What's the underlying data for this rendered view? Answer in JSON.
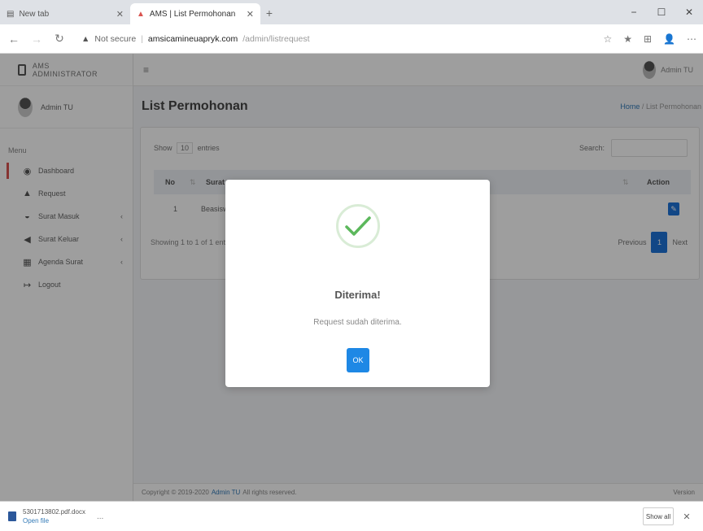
{
  "browser": {
    "tabs": [
      {
        "title": "New tab",
        "active": false
      },
      {
        "title": "AMS | List Permohonan",
        "active": true
      }
    ],
    "new_tab": "+",
    "window": {
      "minimize": "−",
      "maximize": "☐",
      "close": "✕"
    },
    "nav": {
      "back": "←",
      "forward": "→",
      "reload": "↻"
    },
    "address": {
      "security": "Not secure",
      "separator": "|",
      "host": "amsicamineuapryk.com",
      "path": "/admin/listrequest"
    },
    "tools": [
      "☆",
      "★",
      "⊞",
      "👤",
      "⋯"
    ]
  },
  "app": {
    "brand": "AMS ADMINISTRATOR",
    "user_name": "Admin TU",
    "menu_label": "Menu",
    "nav_items": [
      {
        "label": "Dashboard",
        "icon": "dashboard-icon",
        "glyph": "◉",
        "caret": ""
      },
      {
        "label": "Request",
        "icon": "request-icon",
        "glyph": "▲",
        "caret": ""
      },
      {
        "label": "Surat Masuk",
        "icon": "inbox-icon",
        "glyph": "◒",
        "caret": "‹"
      },
      {
        "label": "Surat Keluar",
        "icon": "send-icon",
        "glyph": "◀",
        "caret": "‹"
      },
      {
        "label": "Agenda Surat",
        "icon": "agenda-icon",
        "glyph": "▦",
        "caret": "‹"
      },
      {
        "label": "Logout",
        "icon": "logout-icon",
        "glyph": "↦",
        "caret": ""
      }
    ],
    "topnav": {
      "menu_glyph": "≡",
      "user_name": "Admin TU"
    },
    "page_title": "List Permohonan",
    "breadcrumb": {
      "home": "Home",
      "separator": "/",
      "current": "List Permohonan"
    },
    "table": {
      "show_prefix": "Show",
      "show_value": "10",
      "show_suffix": "entries",
      "search_label": "Search:",
      "headers": {
        "no": "No",
        "surat": "Surat",
        "action": "Action"
      },
      "rows": [
        {
          "no": "1",
          "surat": "Beasiswa"
        }
      ],
      "showing": "Showing 1 to 1 of 1 entries",
      "pagination": {
        "previous": "Previous",
        "page": "1",
        "next": "Next"
      }
    },
    "footer": {
      "prefix": "Copyright © 2019-2020",
      "brand": "Admin TU",
      "suffix": "All rights reserved.",
      "version": "Version"
    }
  },
  "modal": {
    "title": "Diterima!",
    "text": "Request sudah diterima.",
    "ok_label": "OK",
    "success_color": "#5cb85c"
  },
  "download": {
    "file_name": "5301713802.pdf.docx",
    "sub": "Open file",
    "more": "...",
    "show_all": "Show all",
    "close": "✕"
  }
}
